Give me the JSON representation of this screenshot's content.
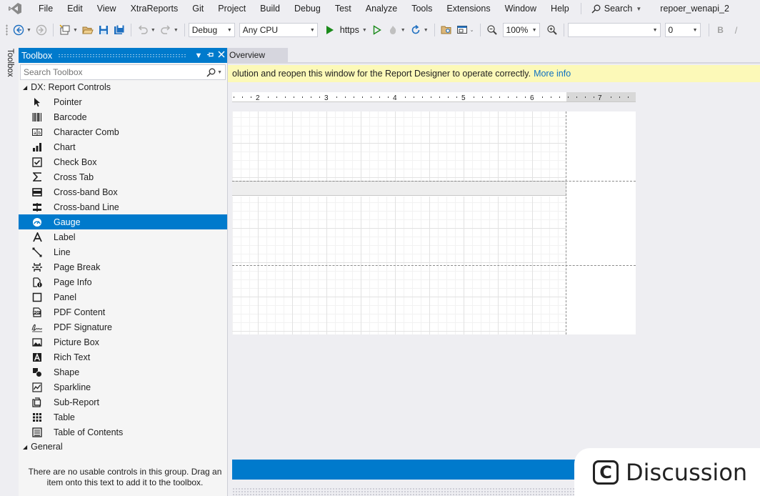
{
  "menubar": {
    "items": [
      "File",
      "Edit",
      "View",
      "XtraReports",
      "Git",
      "Project",
      "Build",
      "Debug",
      "Test",
      "Analyze",
      "Tools",
      "Extensions",
      "Window",
      "Help"
    ],
    "search_label": "Search",
    "solution_name": "repoer_wenapi_2"
  },
  "toolbar": {
    "configuration": "Debug",
    "platform": "Any CPU",
    "run_target": "https",
    "zoom": "100%",
    "font_combo": "",
    "size_combo": "0",
    "bold": "B"
  },
  "toolbox_tab": {
    "label": "Toolbox"
  },
  "toolbox": {
    "title": "Toolbox",
    "search_placeholder": "Search Toolbox",
    "group_report_controls": "DX: Report Controls",
    "items": [
      {
        "label": "Pointer",
        "icon": "pointer-icon"
      },
      {
        "label": "Barcode",
        "icon": "barcode-icon"
      },
      {
        "label": "Character Comb",
        "icon": "character-comb-icon"
      },
      {
        "label": "Chart",
        "icon": "chart-icon"
      },
      {
        "label": "Check Box",
        "icon": "checkbox-icon"
      },
      {
        "label": "Cross Tab",
        "icon": "sigma-icon"
      },
      {
        "label": "Cross-band Box",
        "icon": "crossband-box-icon"
      },
      {
        "label": "Cross-band Line",
        "icon": "crossband-line-icon"
      },
      {
        "label": "Gauge",
        "icon": "gauge-icon"
      },
      {
        "label": "Label",
        "icon": "label-icon"
      },
      {
        "label": "Line",
        "icon": "line-icon"
      },
      {
        "label": "Page Break",
        "icon": "page-break-icon"
      },
      {
        "label": "Page Info",
        "icon": "page-info-icon"
      },
      {
        "label": "Panel",
        "icon": "panel-icon"
      },
      {
        "label": "PDF Content",
        "icon": "pdf-icon"
      },
      {
        "label": "PDF Signature",
        "icon": "signature-icon"
      },
      {
        "label": "Picture Box",
        "icon": "picture-icon"
      },
      {
        "label": "Rich Text",
        "icon": "rich-text-icon"
      },
      {
        "label": "Shape",
        "icon": "shape-icon"
      },
      {
        "label": "Sparkline",
        "icon": "sparkline-icon"
      },
      {
        "label": "Sub-Report",
        "icon": "subreport-icon"
      },
      {
        "label": "Table",
        "icon": "table-icon"
      },
      {
        "label": "Table of Contents",
        "icon": "toc-icon"
      }
    ],
    "selected_item": "Gauge",
    "group_general": "General",
    "empty_note": "There are no usable controls in this group. Drag an item onto this text to add it to the toolbox."
  },
  "document": {
    "tab_label": "Overview",
    "infobar_message": "olution and reopen this window for the Report Designer to operate correctly.",
    "infobar_link": "More info",
    "ruler_labels": [
      "2",
      "3",
      "4",
      "5",
      "6",
      "7"
    ]
  },
  "overlay": {
    "label": "Discussion"
  },
  "colors": {
    "accent": "#007acc",
    "infobar": "#fcf9b8",
    "link": "#0e70c0"
  }
}
